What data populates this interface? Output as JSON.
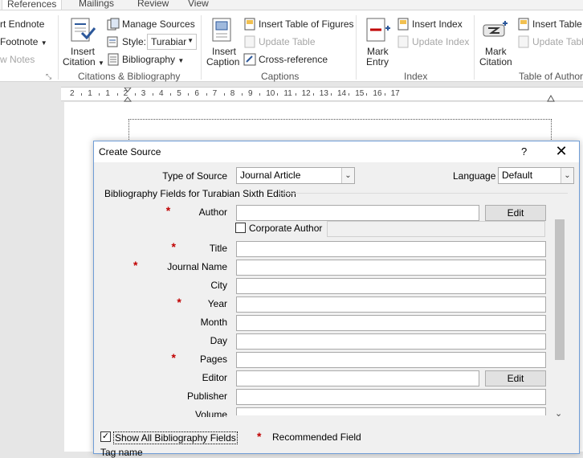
{
  "ribbon": {
    "tabs": [
      "References",
      "Mailings",
      "Review",
      "View"
    ],
    "active_tab": "References",
    "footnotes": {
      "items": [
        "rt Endnote",
        "Footnote",
        "w Notes"
      ],
      "group_launcher": "⤡"
    },
    "citations": {
      "insert_citation_line1": "Insert",
      "insert_citation_line2": "Citation",
      "manage_sources": "Manage Sources",
      "style_label": "Style:",
      "style_value": "Turabiar",
      "bibliography": "Bibliography",
      "group_label": "Citations & Bibliography"
    },
    "captions": {
      "insert_caption_line1": "Insert",
      "insert_caption_line2": "Caption",
      "insert_table_of_figures": "Insert Table of Figures",
      "update_table": "Update Table",
      "cross_reference": "Cross-reference",
      "group_label": "Captions"
    },
    "index": {
      "mark_entry_line1": "Mark",
      "mark_entry_line2": "Entry",
      "insert_index": "Insert Index",
      "update_index": "Update Index",
      "group_label": "Index"
    },
    "authorities": {
      "mark_citation_line1": "Mark",
      "mark_citation_line2": "Citation",
      "insert_table": "Insert Table",
      "update_table": "Update Tabl",
      "group_label": "Table of Author"
    }
  },
  "ruler": {
    "numbers": [
      "2",
      "1",
      "1",
      "2",
      "3",
      "4",
      "5",
      "6",
      "7",
      "8",
      "9",
      "10",
      "11",
      "12",
      "13",
      "14",
      "15",
      "16",
      "17"
    ]
  },
  "dialog": {
    "title": "Create Source",
    "help": "?",
    "close": "✕",
    "type_of_source_label": "Type of Source",
    "type_of_source_value": "Journal Article",
    "language_label": "Language",
    "language_value": "Default",
    "section_label": "Bibliography Fields for Turabian Sixth Edition",
    "required_marker": "*",
    "fields": [
      {
        "label": "Author",
        "required": true,
        "value": "",
        "edit": "Edit"
      },
      {
        "label": "Title",
        "required": true,
        "value": ""
      },
      {
        "label": "Journal Name",
        "required": true,
        "value": ""
      },
      {
        "label": "City",
        "required": false,
        "value": ""
      },
      {
        "label": "Year",
        "required": true,
        "value": ""
      },
      {
        "label": "Month",
        "required": false,
        "value": ""
      },
      {
        "label": "Day",
        "required": false,
        "value": ""
      },
      {
        "label": "Pages",
        "required": true,
        "value": ""
      },
      {
        "label": "Editor",
        "required": false,
        "value": "",
        "edit": "Edit"
      },
      {
        "label": "Publisher",
        "required": false,
        "value": ""
      },
      {
        "label": "Volume",
        "required": false,
        "value": ""
      }
    ],
    "corporate_author_label": "Corporate Author",
    "corporate_author_checked": false,
    "show_all_label": "Show All Bibliography Fields",
    "show_all_checked": true,
    "recommended_label": "Recommended Field",
    "tag_name_label": "Tag name",
    "checkmark": "✓",
    "dropdown_arrow": "⌄",
    "scroll_down_arrow": "⌄"
  },
  "colors": {
    "required": "#c00000",
    "dialog_border": "#6f9dd6"
  }
}
